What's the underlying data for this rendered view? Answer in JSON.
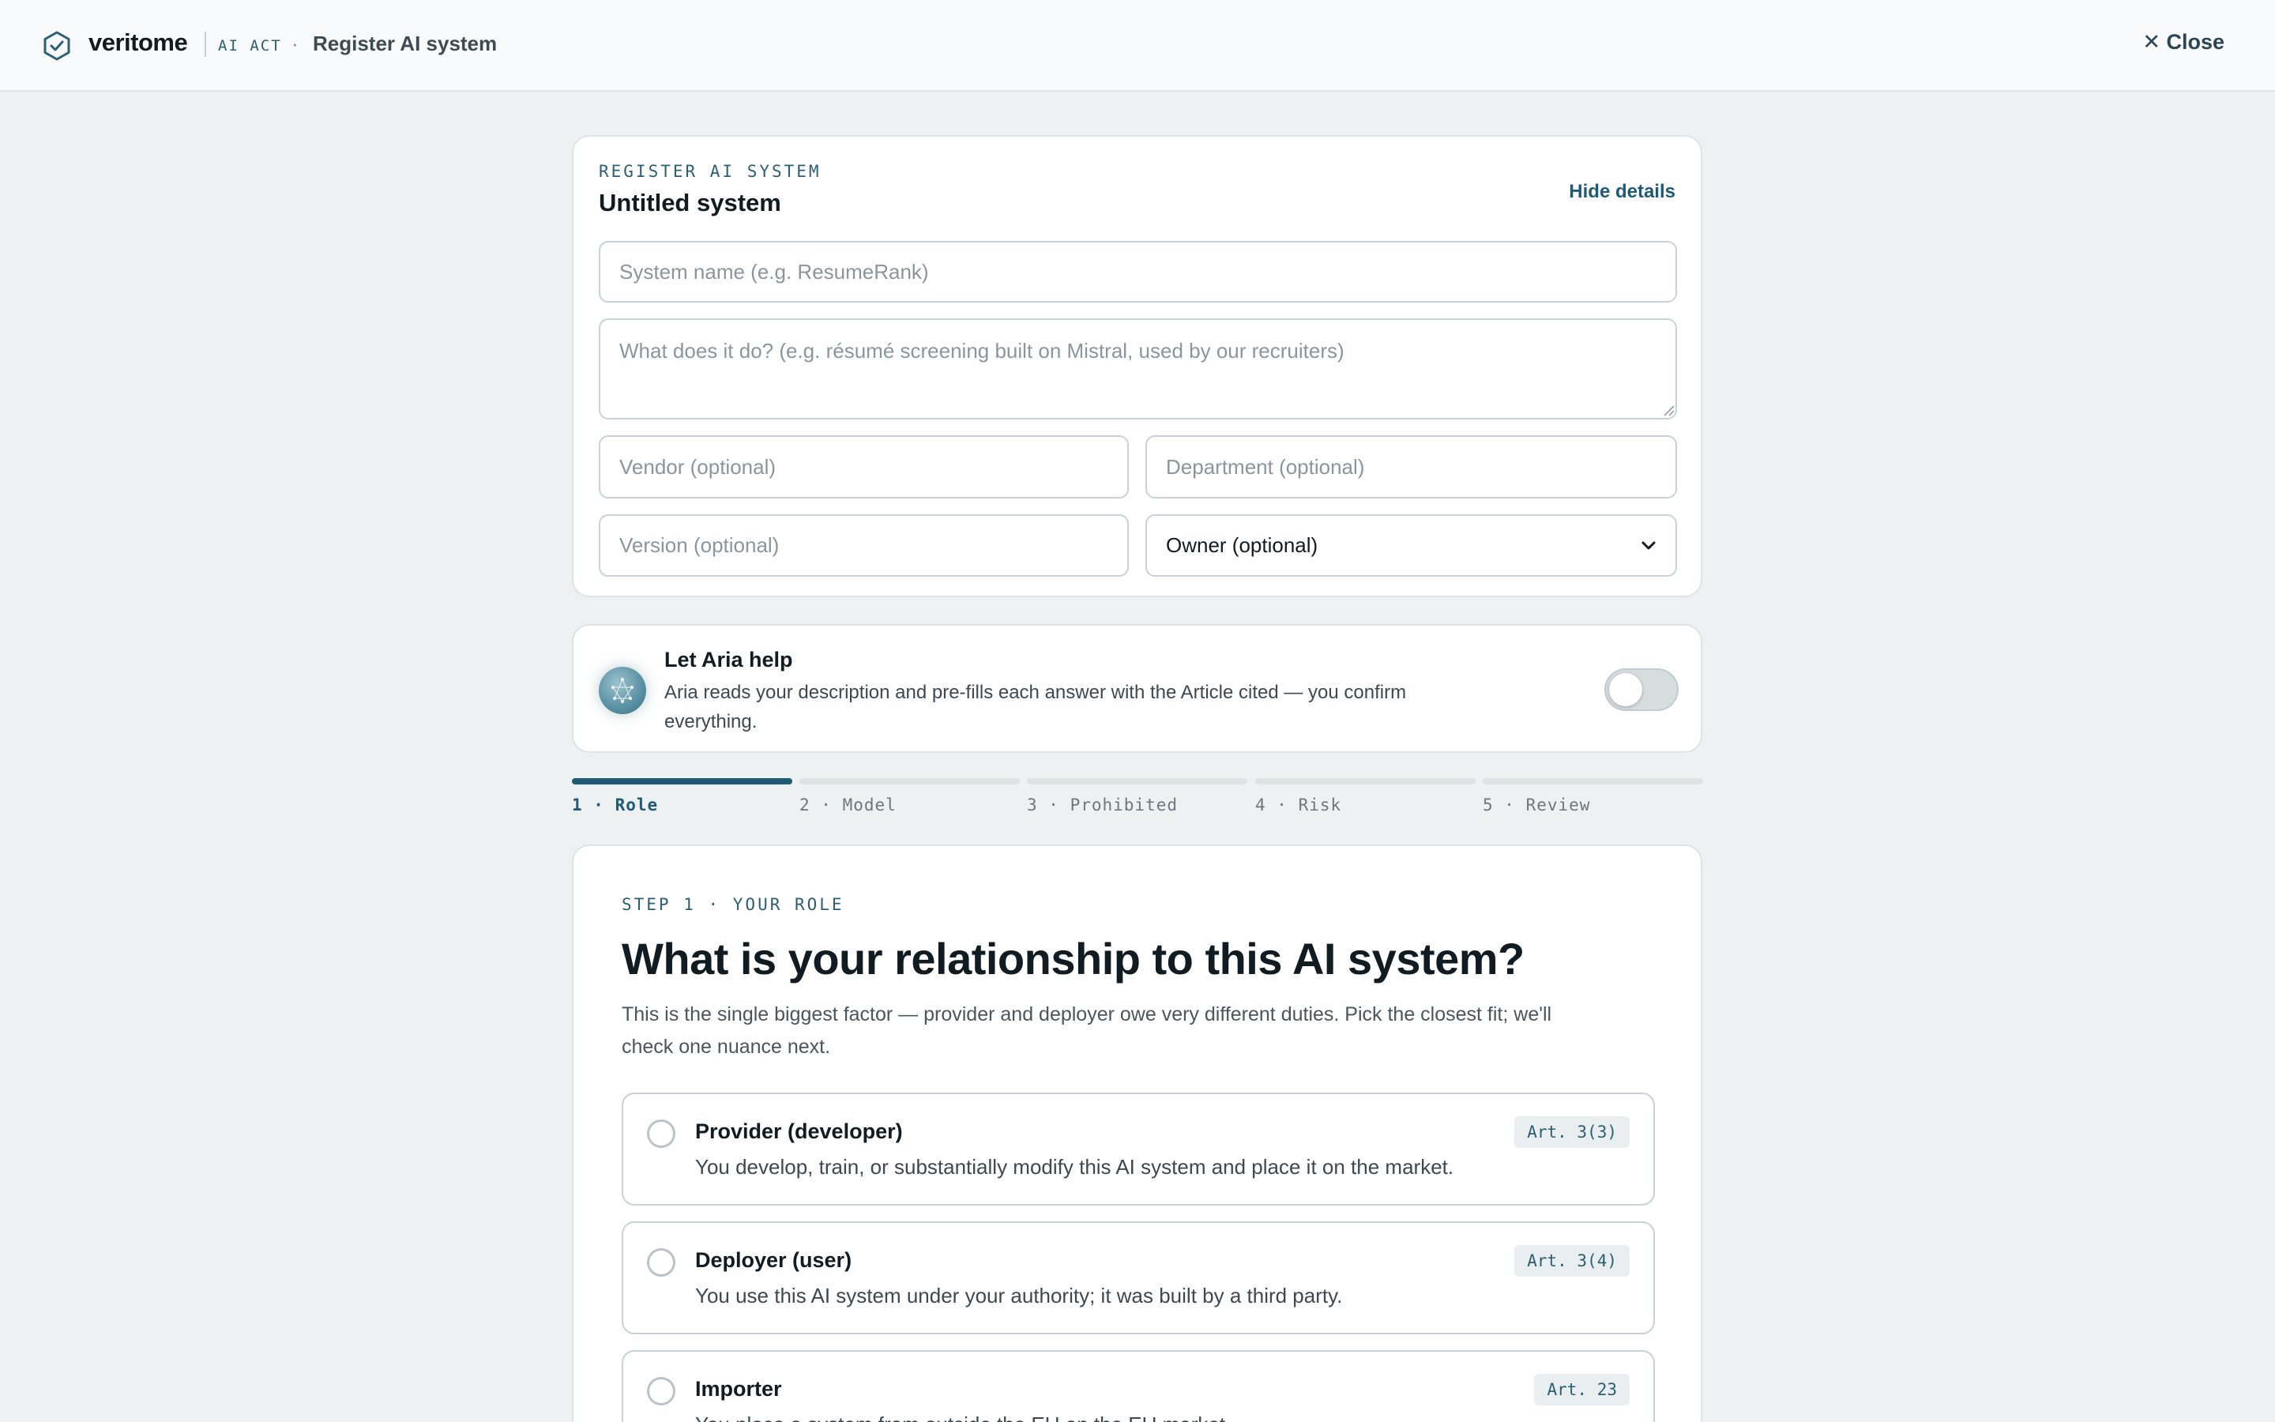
{
  "header": {
    "brand": "veritome",
    "tag": "AI ACT",
    "separator": "·",
    "breadcrumb": "Register AI system",
    "close_label": "✕ Close"
  },
  "register": {
    "eyebrow": "REGISTER AI SYSTEM",
    "title": "Untitled system",
    "hide_label": "Hide details",
    "name_placeholder": "System name (e.g. ResumeRank)",
    "description_placeholder": "What does it do? (e.g. résumé screening built on Mistral, used by our recruiters)",
    "vendor_placeholder": "Vendor (optional)",
    "department_placeholder": "Department (optional)",
    "version_placeholder": "Version (optional)",
    "owner_selected": "Owner (optional)"
  },
  "aria": {
    "title": "Let Aria help",
    "description": "Aria reads your description and pre-fills each answer with the Article cited — you confirm everything.",
    "toggle_on": false
  },
  "steps": [
    {
      "label": "1 · Role",
      "active": true
    },
    {
      "label": "2 · Model",
      "active": false
    },
    {
      "label": "3 · Prohibited",
      "active": false
    },
    {
      "label": "4 · Risk",
      "active": false
    },
    {
      "label": "5 · Review",
      "active": false
    }
  ],
  "role_step": {
    "eyebrow": "STEP 1 · YOUR ROLE",
    "title": "What is your relationship to this AI system?",
    "description": "This is the single biggest factor — provider and deployer owe very different duties. Pick the closest fit; we'll check one nuance next.",
    "options": [
      {
        "title": "Provider (developer)",
        "description": "You develop, train, or substantially modify this AI system and place it on the market.",
        "article": "Art. 3(3)"
      },
      {
        "title": "Deployer (user)",
        "description": "You use this AI system under your authority; it was built by a third party.",
        "article": "Art. 3(4)"
      },
      {
        "title": "Importer",
        "description": "You place a system from outside the EU on the EU market.",
        "article": "Art. 23"
      }
    ]
  },
  "colors": {
    "accent": "#1f5b75",
    "background": "#edf1f2",
    "card": "#ffffff"
  },
  "icons": {
    "brand": "hexagon-check-icon",
    "owner_select": "chevron-down-icon",
    "aria": "aria-avatar-icon"
  }
}
